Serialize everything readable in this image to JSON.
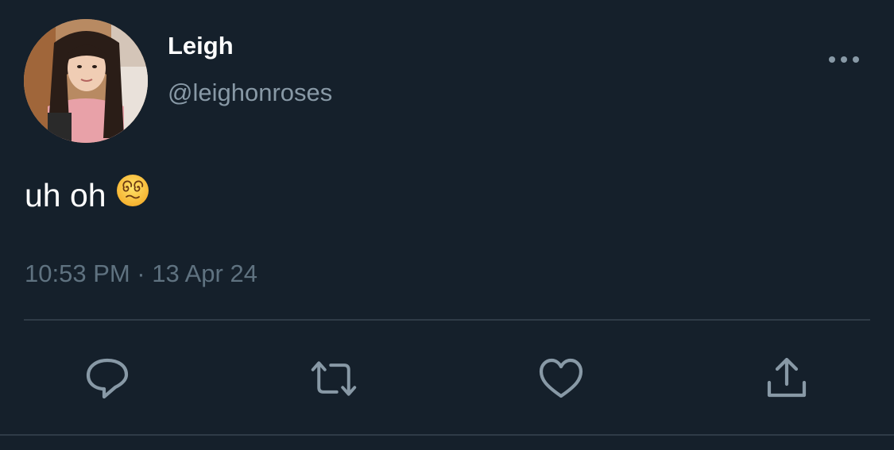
{
  "tweet": {
    "display_name": "Leigh",
    "handle": "@leighonroses",
    "text": "uh oh",
    "emoji": "dizzy-face-emoji",
    "timestamp": "10:53 PM · 13 Apr 24"
  },
  "actions": [
    {
      "icon": "reply-icon"
    },
    {
      "icon": "retweet-icon"
    },
    {
      "icon": "like-icon"
    },
    {
      "icon": "share-icon"
    }
  ],
  "colors": {
    "background": "#15202b",
    "primary_text": "#ffffff",
    "secondary_text": "#8899a6",
    "divider": "#2f3b47"
  }
}
